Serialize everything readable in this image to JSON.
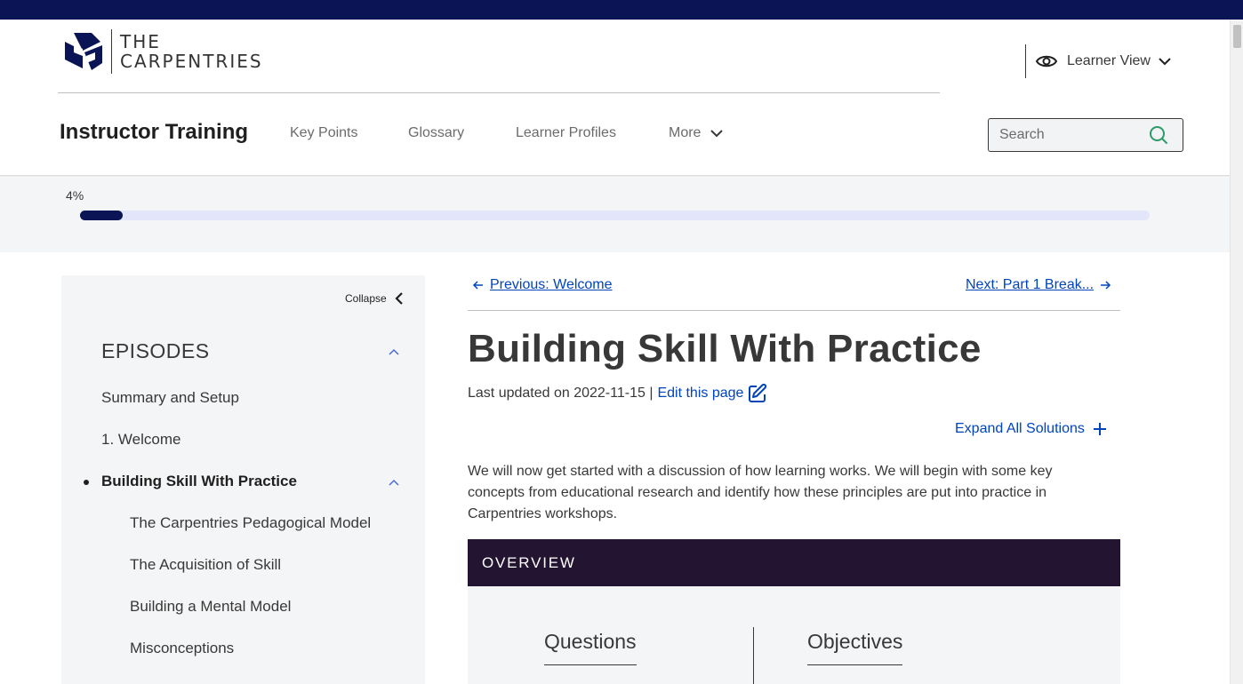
{
  "logo": {
    "line1": "THE",
    "line2": "CARPENTRIES"
  },
  "view_toggle": {
    "label": "Learner View"
  },
  "header": {
    "site_title": "Instructor Training",
    "nav": [
      "Key Points",
      "Glossary",
      "Learner Profiles",
      "More"
    ]
  },
  "search": {
    "placeholder": "Search"
  },
  "progress": {
    "label": "4%",
    "value": 4
  },
  "sidebar": {
    "collapse_label": "Collapse",
    "episodes_heading": "EPISODES",
    "items": [
      "Summary and Setup",
      "1. Welcome",
      "Building Skill With Practice"
    ],
    "subitems": [
      "The Carpentries Pedagogical Model",
      "The Acquisition of Skill",
      "Building a Mental Model",
      "Misconceptions"
    ]
  },
  "pager": {
    "previous": "Previous: Welcome",
    "next": "Next: Part 1 Break..."
  },
  "page": {
    "title": "Building Skill With Practice",
    "updated_prefix": "Last updated on 2022-11-15 |",
    "edit_link": "Edit this page",
    "expand_all": "Expand All Solutions",
    "intro": "We will now get started with a discussion of how learning works. We will begin with some key concepts from educational research and identify how these principles are put into practice in Carpentries workshops."
  },
  "overview": {
    "heading": "OVERVIEW",
    "questions_label": "Questions",
    "objectives_label": "Objectives"
  },
  "colors": {
    "brand_navy": "#0b1556",
    "overview_purple": "#231531",
    "link_blue": "#0044bb",
    "search_icon_green": "#2e9a6a",
    "progress_track": "#e3e6fb"
  },
  "icons": [
    "carpentries-logo-icon",
    "eye-icon",
    "chevron-down-icon",
    "search-icon",
    "chevron-left-icon",
    "caret-up-icon",
    "arrow-left-icon",
    "arrow-right-icon",
    "edit-icon",
    "plus-icon"
  ]
}
